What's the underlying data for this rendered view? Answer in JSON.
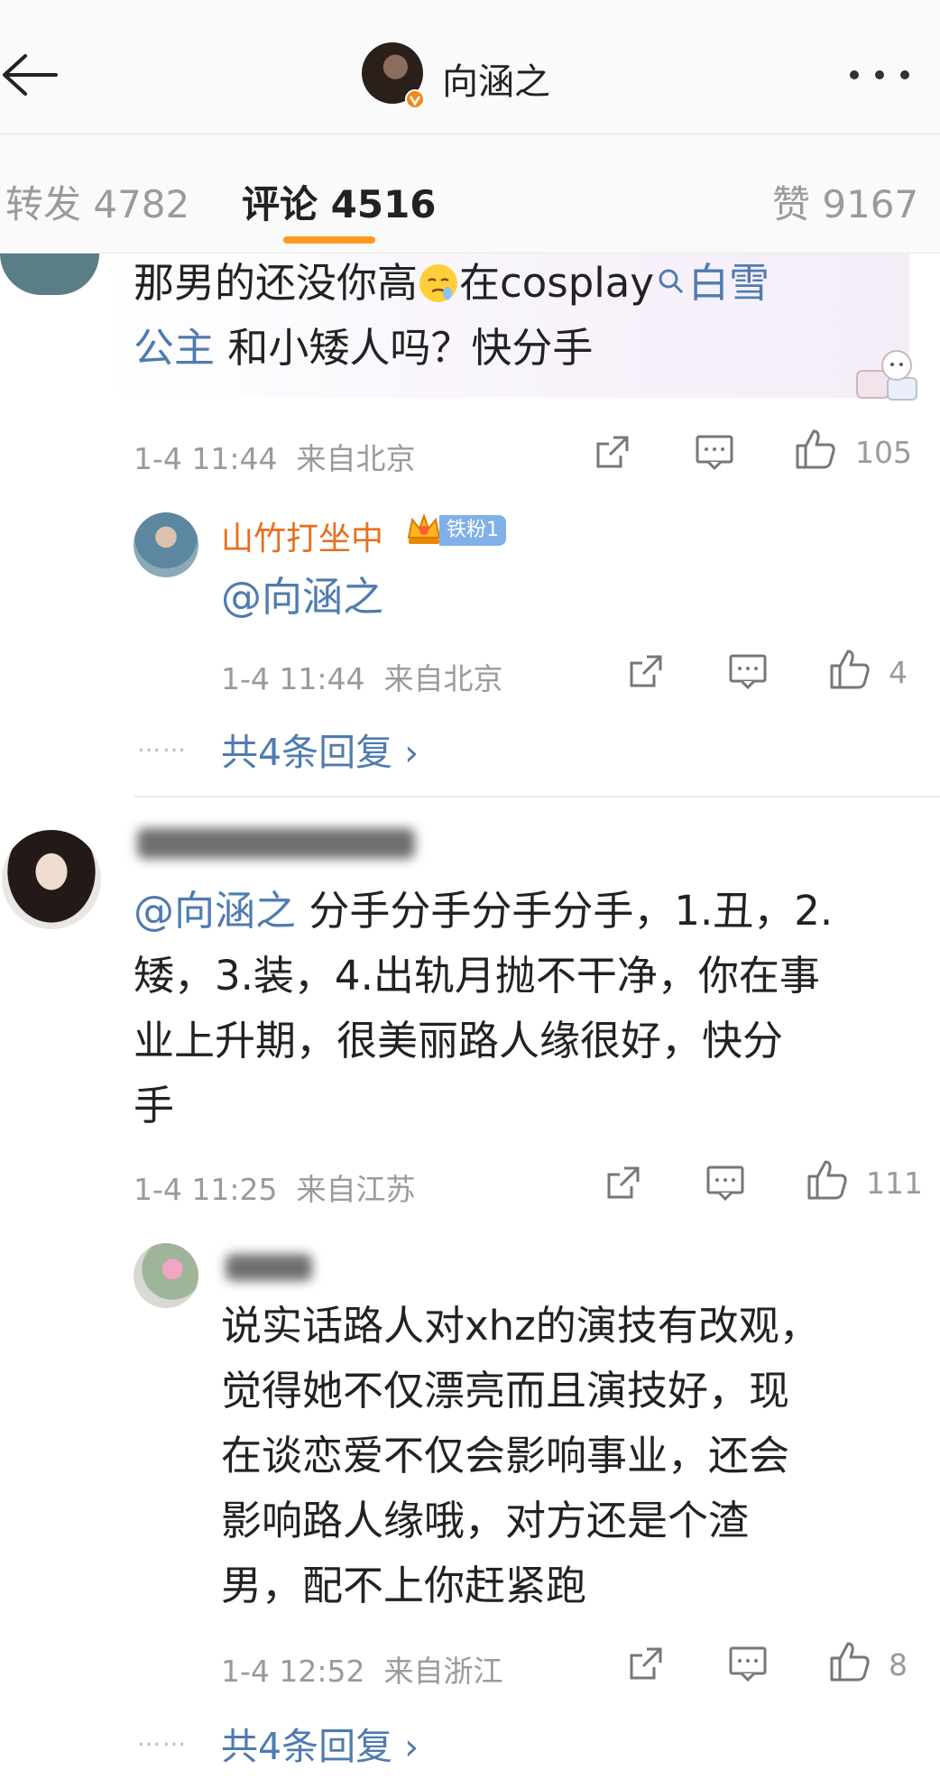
{
  "header": {
    "title": "向涵之",
    "tabs": {
      "repost": "转发 4782",
      "comment": "评论 4516",
      "like": "赞 9167"
    }
  },
  "comments": [
    {
      "text_plain": "那男的还没你高",
      "text_after_emoji": "在cosplay",
      "link1": "白雪",
      "link2": "公主",
      "text_tail": " 和小矮人吗？快分手",
      "time": "1-4 11:44",
      "location": "来自北京",
      "likes": "105",
      "reply": {
        "name": "山竹打坐中",
        "badge": "铁粉1",
        "mention": "@向涵之",
        "time": "1-4 11:44",
        "location": "来自北京",
        "likes": "4",
        "more": "共4条回复",
        "more_arrow": "›",
        "dots": "……"
      }
    },
    {
      "mention": "@向涵之",
      "line1": " 分手分手分手分手，1.丑，2.",
      "line2": "矮，3.装，4.出轨月抛不干净，你在事",
      "line3": "业上升期，很美丽路人缘很好，快分",
      "line4": "手",
      "time": "1-4 11:25",
      "location": "来自江苏",
      "likes": "111",
      "reply": {
        "line1": "说实话路人对xhz的演技有改观，",
        "line2": "觉得她不仅漂亮而且演技好，现",
        "line3": "在谈恋爱不仅会影响事业，还会",
        "line4": "影响路人缘哦，对方还是个渣",
        "line5": "男，配不上你赶紧跑",
        "time": "1-4 12:52",
        "location": "来自浙江",
        "likes": "8",
        "more": "共4条回复",
        "more_arrow": "›",
        "dots": "……"
      }
    }
  ],
  "colors": {
    "accent": "#ff9a1e",
    "link": "#4f7bb0",
    "username": "#e86f1c",
    "badge": "#7fb0e8"
  },
  "icons": [
    "back-arrow-icon",
    "more-icon",
    "verified-badge-icon",
    "share-icon",
    "comment-icon",
    "like-icon",
    "search-icon",
    "crown-icon",
    "emoji-icon"
  ]
}
